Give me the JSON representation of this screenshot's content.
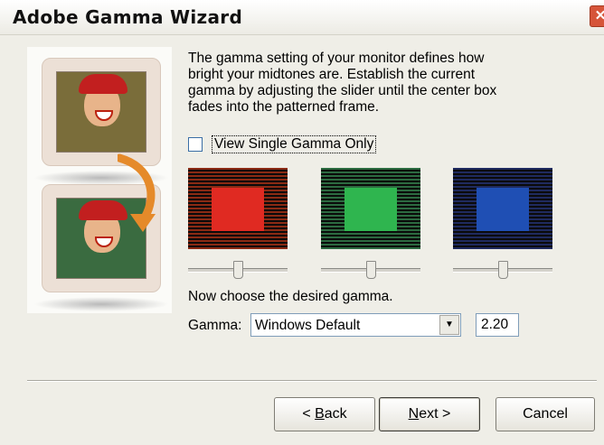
{
  "window": {
    "title": "Adobe Gamma Wizard",
    "close_glyph": "✕"
  },
  "intro_text": "The gamma setting of your monitor defines how bright your midtones are. Establish the current gamma by adjusting the slider until the center box fades into the patterned frame.",
  "view_single": {
    "label": "View Single Gamma Only",
    "checked": false
  },
  "gamma_boxes": [
    {
      "channel": "red",
      "frame_color": "#8a2a14",
      "center_color": "#e02a22",
      "slider_value": 0.5
    },
    {
      "channel": "green",
      "frame_color": "#2c6a40",
      "center_color": "#2fb54f",
      "slider_value": 0.5
    },
    {
      "channel": "blue",
      "frame_color": "#1f2a5e",
      "center_color": "#1f4fb4",
      "slider_value": 0.5
    }
  ],
  "choose_label": "Now choose the desired gamma.",
  "gamma": {
    "label": "Gamma:",
    "selected": "Windows Default",
    "value": "2.20"
  },
  "buttons": {
    "back": {
      "underline": "B",
      "rest": "ack",
      "prefix": "< "
    },
    "next": {
      "underline": "N",
      "rest": "ext >"
    },
    "cancel": "Cancel"
  },
  "icons": {
    "close": "close-icon",
    "dropdown": "chevron-down-icon",
    "arrow": "curved-arrow-icon"
  }
}
